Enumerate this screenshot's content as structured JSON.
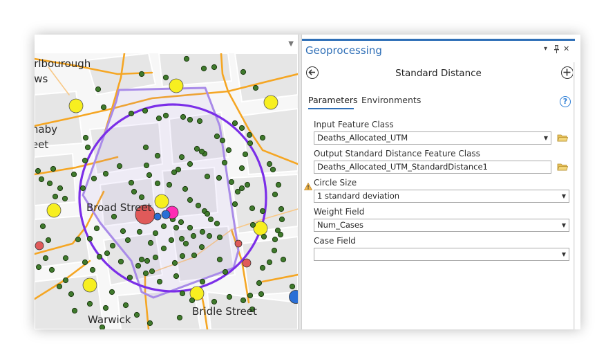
{
  "map": {
    "labels": [
      {
        "text": "arlbourough"
      },
      {
        "text": "ews"
      },
      {
        "text": "rnaby"
      },
      {
        "text": "reet"
      },
      {
        "text": "Broad Street"
      },
      {
        "text": "Bridle Street"
      },
      {
        "text": "Warwick"
      }
    ],
    "colors": {
      "background": "#f7f7f7",
      "block": "#e6e6e6",
      "street": "#f5a623",
      "circle": "#7b2ee8",
      "polygon": "#a98be8",
      "death_point": "#3f7a2c",
      "pump_yellow": "#f7ef20",
      "pump_blue": "#2a6fd6"
    }
  },
  "panel": {
    "title": "Geoprocessing",
    "tool_title": "Standard Distance",
    "header_buttons": {
      "menu": "▾",
      "pin": "📌",
      "close": "✕"
    },
    "tabs": [
      {
        "label": "Parameters",
        "active": true
      },
      {
        "label": "Environments",
        "active": false
      }
    ],
    "help": "?",
    "params": {
      "input": {
        "label": "Input Feature Class",
        "value": "Deaths_Allocated_UTM"
      },
      "output": {
        "label": "Output Standard Distance Feature Class",
        "value": "Deaths_Allocated_UTM_StandardDistance1"
      },
      "circle_size": {
        "label": "Circle Size",
        "value": "1 standard deviation"
      },
      "weight": {
        "label": "Weight Field",
        "value": "Num_Cases"
      },
      "case": {
        "label": "Case Field",
        "value": ""
      }
    },
    "accent_color": "#2f6fb7"
  }
}
